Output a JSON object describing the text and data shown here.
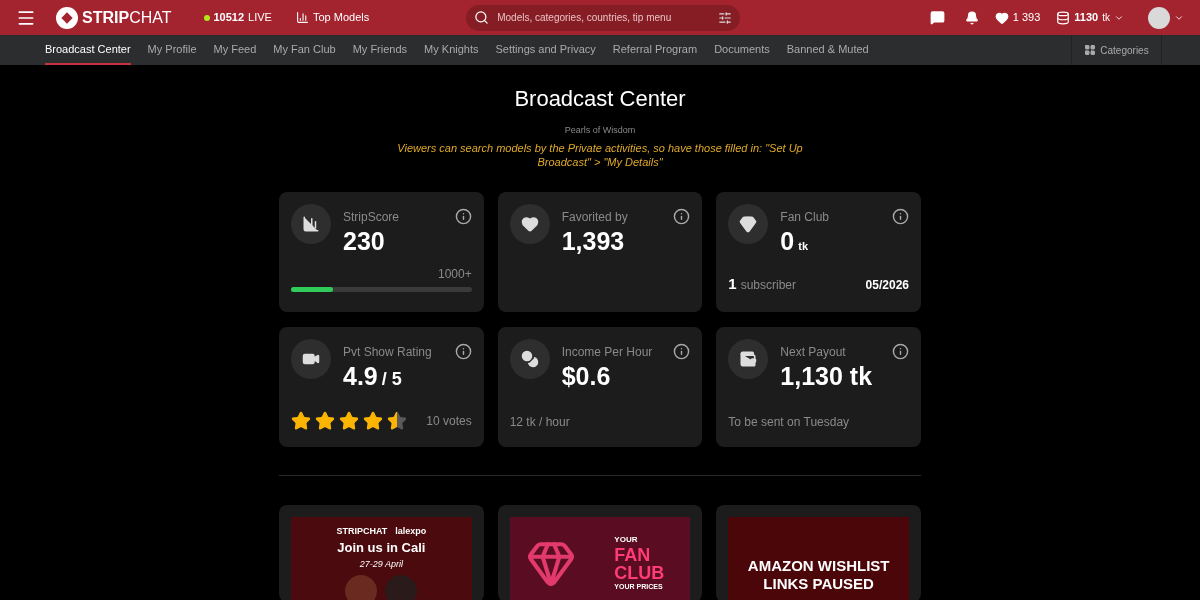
{
  "header": {
    "logo": {
      "strong": "STRIP",
      "light": "CHAT"
    },
    "live": {
      "count": "10512",
      "label": "LIVE"
    },
    "top_models": "Top Models",
    "search": {
      "placeholder": "Models, categories, countries, tip menu"
    },
    "favorites": "1 393",
    "tokens": {
      "amount": "1130",
      "unit": "tk"
    }
  },
  "nav": {
    "items": [
      {
        "label": "Broadcast Center",
        "selected": true
      },
      {
        "label": "My Profile",
        "selected": false
      },
      {
        "label": "My Feed",
        "selected": false
      },
      {
        "label": "My Fan Club",
        "selected": false
      },
      {
        "label": "My Friends",
        "selected": false
      },
      {
        "label": "My Knights",
        "selected": false
      },
      {
        "label": "Settings and Privacy",
        "selected": false
      },
      {
        "label": "Referral Program",
        "selected": false
      },
      {
        "label": "Documents",
        "selected": false
      },
      {
        "label": "Banned & Muted",
        "selected": false
      }
    ],
    "categories": "Categories"
  },
  "page": {
    "title": "Broadcast Center",
    "tip_title": "Pearls of Wisdom",
    "tip": "Viewers can search models by the Private activities, so have those filled in: \"Set Up Broadcast\" > \"My Details\""
  },
  "cards": [
    {
      "kind": "score",
      "label": "StripScore",
      "value": "230",
      "max_label": "1000+",
      "level": 0.23
    },
    {
      "kind": "plain",
      "label": "Favorited by",
      "value": "1,393"
    },
    {
      "kind": "fanclub",
      "label": "Fan Club",
      "value": "0",
      "unit": "tk",
      "count": "1",
      "count_label": "subscriber",
      "date": "05/2026"
    },
    {
      "kind": "rating",
      "label": "Pvt Show Rating",
      "value": "4.9",
      "unit": "/ 5",
      "stars": 4.5,
      "votes": "10 votes"
    },
    {
      "kind": "note",
      "label": "Income Per Hour",
      "value": "$0.6",
      "note": "12 tk / hour"
    },
    {
      "kind": "note",
      "label": "Next Payout",
      "value": "1,130 tk",
      "note": "To be sent on Tuesday"
    }
  ],
  "banners": [
    {
      "kind": "event",
      "logos": [
        "STRIPCHAT",
        "lalexpo"
      ],
      "headline": "Join us in Cali",
      "subline": "27-29 April"
    },
    {
      "kind": "fanclub",
      "top": "YOUR",
      "headline": "FAN CLUB",
      "subline": "YOUR PRICES"
    },
    {
      "kind": "notice",
      "headline": "AMAZON WISHLIST LINKS PAUSED"
    }
  ]
}
